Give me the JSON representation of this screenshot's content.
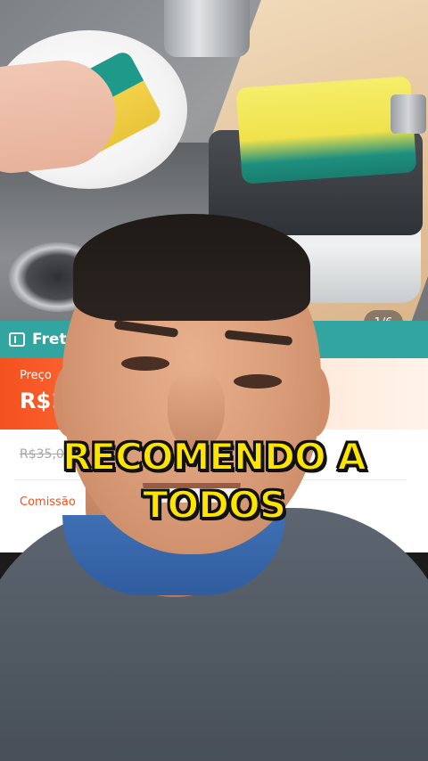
{
  "product": {
    "image_pager": "1/6",
    "frete_label": "Frete",
    "price_label": "Preço",
    "price_value": "R$1",
    "old_price": "R$35,0",
    "comissao_label": "Comissão"
  },
  "caption": {
    "line1": "RECOMENDO A",
    "line2": "TODOS"
  },
  "colors": {
    "frete_bar": "#33a5a0",
    "price_accent": "#f4511e",
    "caption_fill": "#ffe400",
    "caption_outline": "#111111"
  }
}
